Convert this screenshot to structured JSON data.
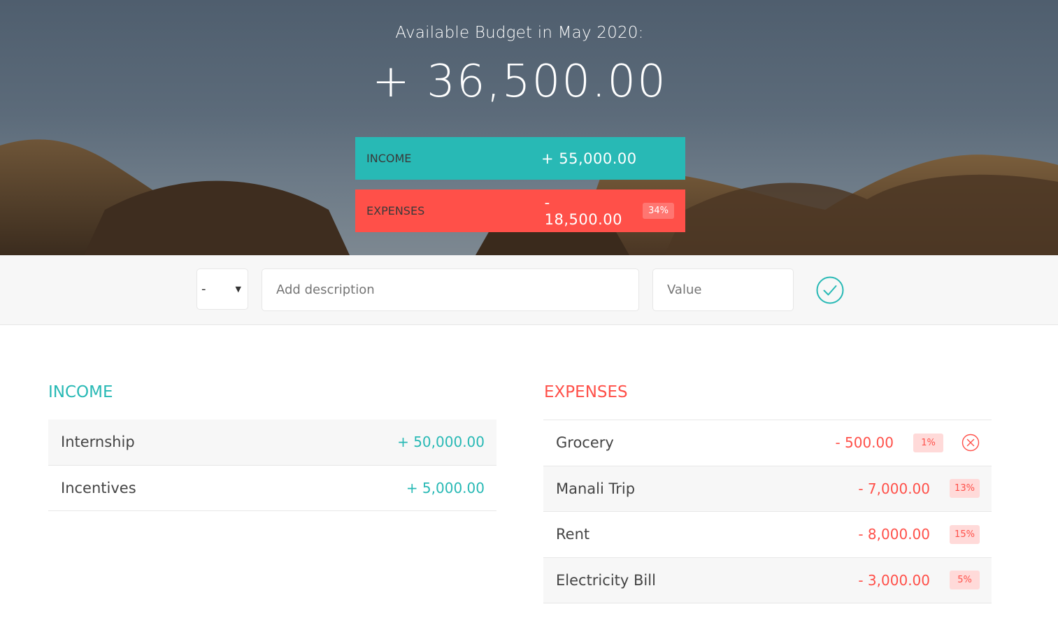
{
  "header": {
    "title": "Available Budget in May 2020:",
    "budget": "+ 36,500.00",
    "income": {
      "label": "Income",
      "value": "+ 55,000.00"
    },
    "expenses": {
      "label": "Expenses",
      "value": "- 18,500.00",
      "percentage": "34%"
    }
  },
  "add_form": {
    "type_selected": "-",
    "description_placeholder": "Add description",
    "value_placeholder": "Value",
    "submit_icon": "check-circle-icon"
  },
  "income_list": {
    "title": "Income",
    "items": [
      {
        "description": "Internship",
        "value": "+ 50,000.00"
      },
      {
        "description": "Incentives",
        "value": "+ 5,000.00"
      }
    ]
  },
  "expenses_list": {
    "title": "Expenses",
    "items": [
      {
        "description": "Grocery",
        "value": "- 500.00",
        "percentage": "1%"
      },
      {
        "description": "Manali Trip",
        "value": "- 7,000.00",
        "percentage": "13%"
      },
      {
        "description": "Rent",
        "value": "- 8,000.00",
        "percentage": "15%"
      },
      {
        "description": "Electricity Bill",
        "value": "- 3,000.00",
        "percentage": "5%"
      }
    ]
  },
  "colors": {
    "income": "#28b9b5",
    "expenses": "#ff5049"
  }
}
